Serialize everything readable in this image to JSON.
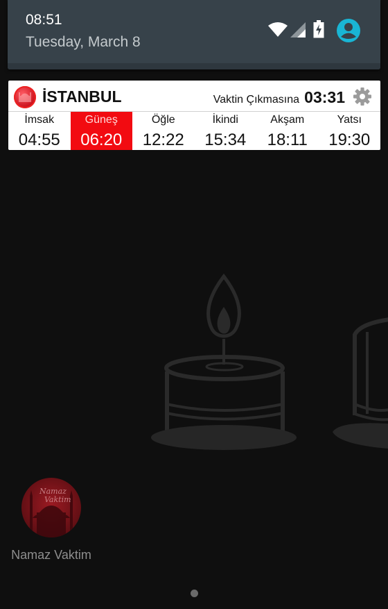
{
  "status_bar": {
    "time": "08:51",
    "date": "Tuesday, March 8",
    "icons": [
      "wifi-icon",
      "cell-signal-icon",
      "battery-charging-icon",
      "user-avatar-icon"
    ],
    "accent_color": "#19b5d4"
  },
  "widget": {
    "city": "İSTANBUL",
    "countdown_label": "Vaktin Çıkmasına",
    "countdown_value": "03:31",
    "active_color": "#f20b11",
    "prayers": [
      {
        "name": "İmsak",
        "time": "04:55",
        "active": false
      },
      {
        "name": "Güneş",
        "time": "06:20",
        "active": true
      },
      {
        "name": "Öğle",
        "time": "12:22",
        "active": false
      },
      {
        "name": "İkindi",
        "time": "15:34",
        "active": false
      },
      {
        "name": "Akşam",
        "time": "18:11",
        "active": false
      },
      {
        "name": "Yatsı",
        "time": "19:30",
        "active": false
      }
    ]
  },
  "home": {
    "shortcut_label": "Namaz Vaktim",
    "shortcut_logo_text_1": "Namaz",
    "shortcut_logo_text_2": "Vaktim",
    "page_indicator_count": 1
  }
}
